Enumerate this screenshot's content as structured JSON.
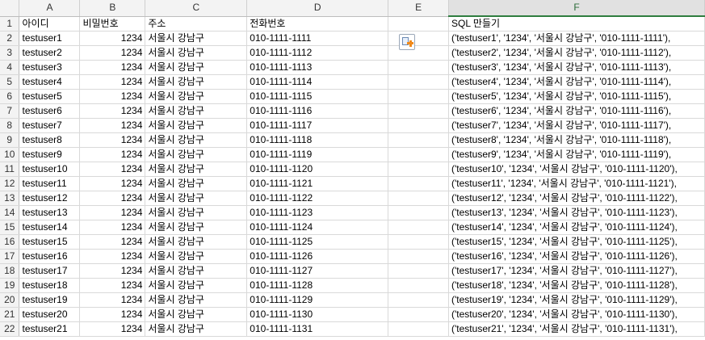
{
  "columns": [
    "A",
    "B",
    "C",
    "D",
    "E",
    "F"
  ],
  "header_row": {
    "row_num": "1",
    "cells": [
      "아이디",
      "비밀번호",
      "주소",
      "전화번호",
      "",
      "SQL 만들기"
    ]
  },
  "rows": [
    {
      "n": "2",
      "id": "testuser1",
      "pw": "1234",
      "addr": "서울시 강남구",
      "tel": "010-1111-1111",
      "e": "",
      "sql": "('testuser1', '1234', '서울시 강남구', '010-1111-1111'),"
    },
    {
      "n": "3",
      "id": "testuser2",
      "pw": "1234",
      "addr": "서울시 강남구",
      "tel": "010-1111-1112",
      "e": "",
      "sql": "('testuser2', '1234', '서울시 강남구', '010-1111-1112'),"
    },
    {
      "n": "4",
      "id": "testuser3",
      "pw": "1234",
      "addr": "서울시 강남구",
      "tel": "010-1111-1113",
      "e": "",
      "sql": "('testuser3', '1234', '서울시 강남구', '010-1111-1113'),"
    },
    {
      "n": "5",
      "id": "testuser4",
      "pw": "1234",
      "addr": "서울시 강남구",
      "tel": "010-1111-1114",
      "e": "",
      "sql": "('testuser4', '1234', '서울시 강남구', '010-1111-1114'),"
    },
    {
      "n": "6",
      "id": "testuser5",
      "pw": "1234",
      "addr": "서울시 강남구",
      "tel": "010-1111-1115",
      "e": "",
      "sql": "('testuser5', '1234', '서울시 강남구', '010-1111-1115'),"
    },
    {
      "n": "7",
      "id": "testuser6",
      "pw": "1234",
      "addr": "서울시 강남구",
      "tel": "010-1111-1116",
      "e": "",
      "sql": "('testuser6', '1234', '서울시 강남구', '010-1111-1116'),"
    },
    {
      "n": "8",
      "id": "testuser7",
      "pw": "1234",
      "addr": "서울시 강남구",
      "tel": "010-1111-1117",
      "e": "",
      "sql": "('testuser7', '1234', '서울시 강남구', '010-1111-1117'),"
    },
    {
      "n": "9",
      "id": "testuser8",
      "pw": "1234",
      "addr": "서울시 강남구",
      "tel": "010-1111-1118",
      "e": "",
      "sql": "('testuser8', '1234', '서울시 강남구', '010-1111-1118'),"
    },
    {
      "n": "10",
      "id": "testuser9",
      "pw": "1234",
      "addr": "서울시 강남구",
      "tel": "010-1111-1119",
      "e": "",
      "sql": "('testuser9', '1234', '서울시 강남구', '010-1111-1119'),"
    },
    {
      "n": "11",
      "id": "testuser10",
      "pw": "1234",
      "addr": "서울시 강남구",
      "tel": "010-1111-1120",
      "e": "",
      "sql": "('testuser10', '1234', '서울시 강남구', '010-1111-1120'),"
    },
    {
      "n": "12",
      "id": "testuser11",
      "pw": "1234",
      "addr": "서울시 강남구",
      "tel": "010-1111-1121",
      "e": "",
      "sql": "('testuser11', '1234', '서울시 강남구', '010-1111-1121'),"
    },
    {
      "n": "13",
      "id": "testuser12",
      "pw": "1234",
      "addr": "서울시 강남구",
      "tel": "010-1111-1122",
      "e": "",
      "sql": "('testuser12', '1234', '서울시 강남구', '010-1111-1122'),"
    },
    {
      "n": "14",
      "id": "testuser13",
      "pw": "1234",
      "addr": "서울시 강남구",
      "tel": "010-1111-1123",
      "e": "",
      "sql": "('testuser13', '1234', '서울시 강남구', '010-1111-1123'),"
    },
    {
      "n": "15",
      "id": "testuser14",
      "pw": "1234",
      "addr": "서울시 강남구",
      "tel": "010-1111-1124",
      "e": "",
      "sql": "('testuser14', '1234', '서울시 강남구', '010-1111-1124'),"
    },
    {
      "n": "16",
      "id": "testuser15",
      "pw": "1234",
      "addr": "서울시 강남구",
      "tel": "010-1111-1125",
      "e": "",
      "sql": "('testuser15', '1234', '서울시 강남구', '010-1111-1125'),"
    },
    {
      "n": "17",
      "id": "testuser16",
      "pw": "1234",
      "addr": "서울시 강남구",
      "tel": "010-1111-1126",
      "e": "",
      "sql": "('testuser16', '1234', '서울시 강남구', '010-1111-1126'),"
    },
    {
      "n": "18",
      "id": "testuser17",
      "pw": "1234",
      "addr": "서울시 강남구",
      "tel": "010-1111-1127",
      "e": "",
      "sql": "('testuser17', '1234', '서울시 강남구', '010-1111-1127'),"
    },
    {
      "n": "19",
      "id": "testuser18",
      "pw": "1234",
      "addr": "서울시 강남구",
      "tel": "010-1111-1128",
      "e": "",
      "sql": "('testuser18', '1234', '서울시 강남구', '010-1111-1128'),"
    },
    {
      "n": "20",
      "id": "testuser19",
      "pw": "1234",
      "addr": "서울시 강남구",
      "tel": "010-1111-1129",
      "e": "",
      "sql": "('testuser19', '1234', '서울시 강남구', '010-1111-1129'),"
    },
    {
      "n": "21",
      "id": "testuser20",
      "pw": "1234",
      "addr": "서울시 강남구",
      "tel": "010-1111-1130",
      "e": "",
      "sql": "('testuser20', '1234', '서울시 강남구', '010-1111-1130'),"
    },
    {
      "n": "22",
      "id": "testuser21",
      "pw": "1234",
      "addr": "서울시 강남구",
      "tel": "010-1111-1131",
      "e": "",
      "sql": "('testuser21', '1234', '서울시 강남구', '010-1111-1131'),"
    }
  ],
  "paste_options": {
    "icon": "paste-options-icon"
  },
  "colors": {
    "header_bg": "#f3f3f3",
    "selected_col_bg": "#e1e1e1",
    "selected_col_accent": "#2f7d3f",
    "gridline": "#d9d9d9"
  }
}
